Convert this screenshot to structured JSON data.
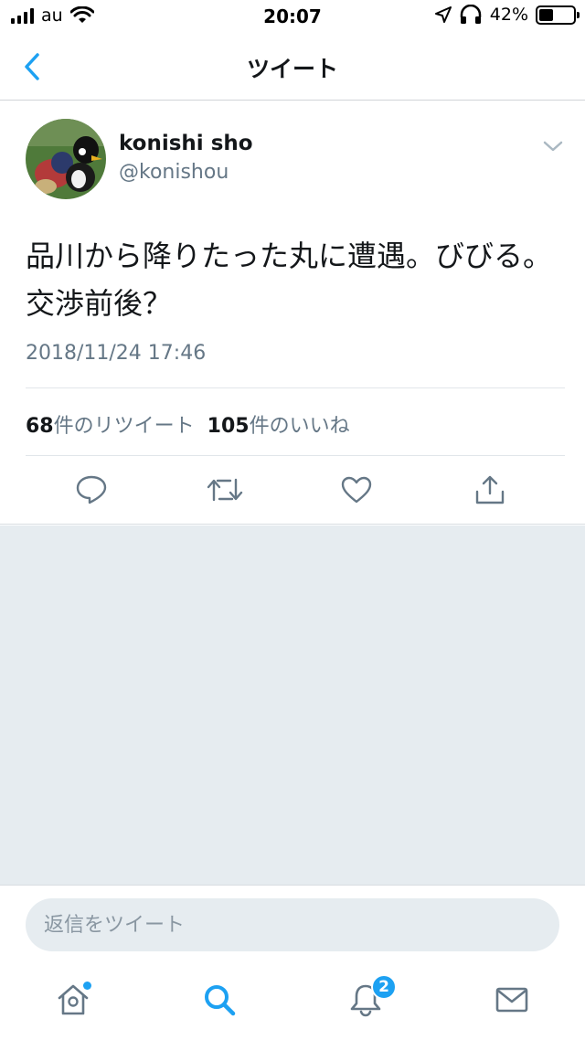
{
  "status_bar": {
    "carrier": "au",
    "time": "20:07",
    "battery_percent": "42%",
    "battery_level": 0.42,
    "icons": [
      "signal-icon",
      "wifi-icon",
      "location-arrow-icon",
      "headphones-icon",
      "battery-icon"
    ]
  },
  "nav": {
    "title": "ツイート",
    "back_icon": "chevron-left-icon"
  },
  "tweet": {
    "author": {
      "name": "konishi sho",
      "handle": "@konishou"
    },
    "text": "品川から降りたった丸に遭遇。びびる。交渉前後？",
    "timestamp": "2018/11/24 17:46",
    "stats": {
      "retweet_count": "68",
      "retweet_label": "件のリツイート",
      "like_count": "105",
      "like_label": "件のいいね"
    },
    "actions": [
      "reply-icon",
      "retweet-icon",
      "like-icon",
      "share-icon"
    ]
  },
  "reply": {
    "placeholder": "返信をツイート"
  },
  "tab_bar": {
    "items": [
      "home-icon",
      "search-icon",
      "notifications-icon",
      "messages-icon"
    ],
    "notifications_badge": "2"
  },
  "colors": {
    "accent": "#1da1f2",
    "text": "#14171a",
    "secondary_text": "#657786",
    "background_gray": "#e6ecf0"
  }
}
